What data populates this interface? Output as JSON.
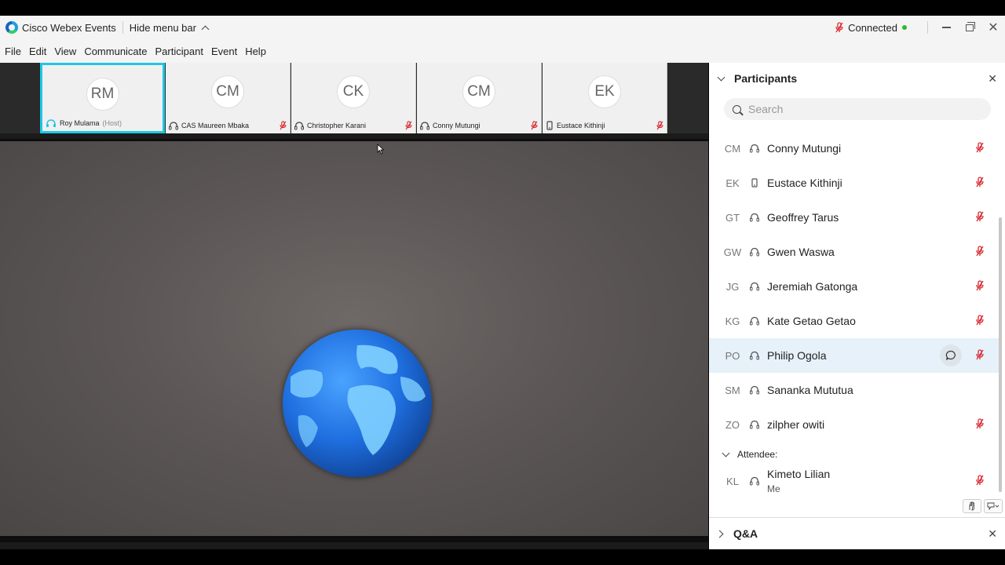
{
  "titlebar": {
    "app_title": "Cisco Webex Events",
    "hide_menu_label": "Hide menu bar",
    "connection_status": "Connected"
  },
  "menu": [
    "File",
    "Edit",
    "View",
    "Communicate",
    "Participant",
    "Event",
    "Help"
  ],
  "thumbnails": [
    {
      "initials": "RM",
      "name": "Roy Mulama",
      "role": "(Host)",
      "selected": true,
      "device": "headset-video"
    },
    {
      "initials": "CM",
      "name": "CAS Maureen Mbaka",
      "role": "",
      "selected": false,
      "device": "headset"
    },
    {
      "initials": "CK",
      "name": "Christopher Karani",
      "role": "",
      "selected": false,
      "device": "headset"
    },
    {
      "initials": "CM",
      "name": "Conny Mutungi",
      "role": "",
      "selected": false,
      "device": "headset"
    },
    {
      "initials": "EK",
      "name": "Eustace Kithinji",
      "role": "",
      "selected": false,
      "device": "phone"
    }
  ],
  "panel": {
    "title": "Participants",
    "search_placeholder": "Search",
    "participants": [
      {
        "initials": "CM",
        "name": "Conny Mutungi",
        "device": "headset",
        "muted": true
      },
      {
        "initials": "EK",
        "name": "Eustace Kithinji",
        "device": "phone",
        "muted": true
      },
      {
        "initials": "GT",
        "name": "Geoffrey Tarus",
        "device": "headset",
        "muted": true
      },
      {
        "initials": "GW",
        "name": "Gwen Waswa",
        "device": "headset",
        "muted": true
      },
      {
        "initials": "JG",
        "name": "Jeremiah Gatonga",
        "device": "headset",
        "muted": true
      },
      {
        "initials": "KG",
        "name": "Kate Getao Getao",
        "device": "headset",
        "muted": true
      },
      {
        "initials": "PO",
        "name": "Philip Ogola",
        "device": "headset",
        "muted": true,
        "highlighted": true
      },
      {
        "initials": "SM",
        "name": "Sananka Mututua",
        "device": "headset",
        "muted": false
      },
      {
        "initials": "ZO",
        "name": "zilpher owiti",
        "device": "headset",
        "muted": true
      }
    ],
    "attendee_header": "Attendee:",
    "attendee": {
      "initials": "KL",
      "name": "Kimeto Lilian",
      "sub": "Me",
      "device": "headset",
      "muted": true
    },
    "qa_title": "Q&A"
  },
  "colors": {
    "accent": "#1ec7e6",
    "muted_mic": "#d9262f",
    "connected_dot": "#2eb82e"
  }
}
